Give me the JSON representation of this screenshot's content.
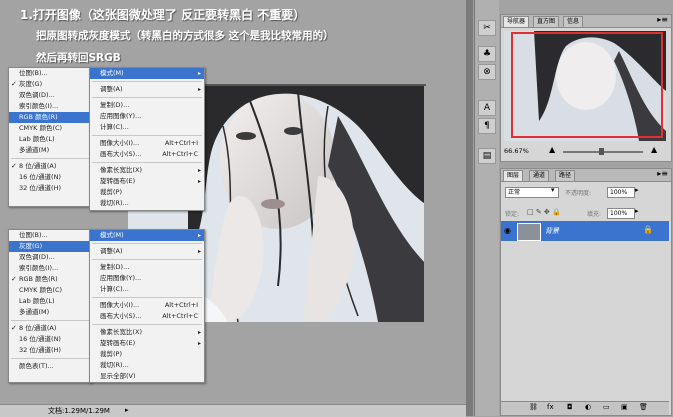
{
  "instructions": {
    "line1": "1.打开图像（这张图微处理了 反正要转黑白 不重要）",
    "line2": "把原图转成灰度模式（转黑白的方式很多 这个是我比较常用的）",
    "line3": "然后再转回SRGB"
  },
  "menu1": {
    "mode_items": [
      "位图(B)...",
      "灰度(G)",
      "双色调(D)...",
      "索引颜色(I)...",
      "RGB 颜色(R)",
      "CMYK 颜色(C)",
      "Lab 颜色(L)",
      "多通道(M)",
      "8 位/通道(A)",
      "16 位/通道(N)",
      "32 位/通道(H)"
    ],
    "image_items": [
      "模式(M)",
      "调整(A)",
      "复制(D)...",
      "应用图像(Y)...",
      "计算(C)...",
      "图像大小(I)...",
      "画布大小(S)...",
      "像素长宽比(X)",
      "旋转画布(E)",
      "裁剪(P)",
      "裁切(R)..."
    ],
    "shortcut1": "Alt+Ctrl+I",
    "shortcut2": "Alt+Ctrl+C"
  },
  "menu2": {
    "mode_items": [
      "位图(B)...",
      "灰度(G)",
      "双色调(D)...",
      "索引颜色(I)...",
      "RGB 颜色(R)",
      "CMYK 颜色(C)",
      "Lab 颜色(L)",
      "多通道(M)",
      "8 位/通道(A)",
      "16 位/通道(N)",
      "32 位/通道(H)",
      "颜色表(T)..."
    ],
    "image_items": [
      "模式(M)",
      "调整(A)",
      "复制(D)...",
      "应用图像(Y)...",
      "计算(C)...",
      "图像大小(I)...",
      "画布大小(S)...",
      "像素长宽比(X)",
      "旋转画布(E)",
      "裁剪(P)",
      "裁切(R)...",
      "显示全部(V)"
    ],
    "shortcut1": "Alt+Ctrl+I",
    "shortcut2": "Alt+Ctrl+C"
  },
  "status": {
    "doc_info": "文档:1.29M/1.29M"
  },
  "navigator": {
    "tabs": [
      "导航器",
      "直方图",
      "信息"
    ],
    "zoom": "66.67%"
  },
  "layers": {
    "tabs": [
      "图层",
      "通道",
      "路径"
    ],
    "blend_mode": "正常",
    "opacity_label": "不透明度:",
    "opacity_value": "100%",
    "lock_label": "锁定:",
    "fill_label": "填充:",
    "fill_value": "100%",
    "layer_name": "背景"
  },
  "colors": {
    "selection": "#3b74cf",
    "nav_frame": "#e03030",
    "text_white": "#ffffff"
  }
}
